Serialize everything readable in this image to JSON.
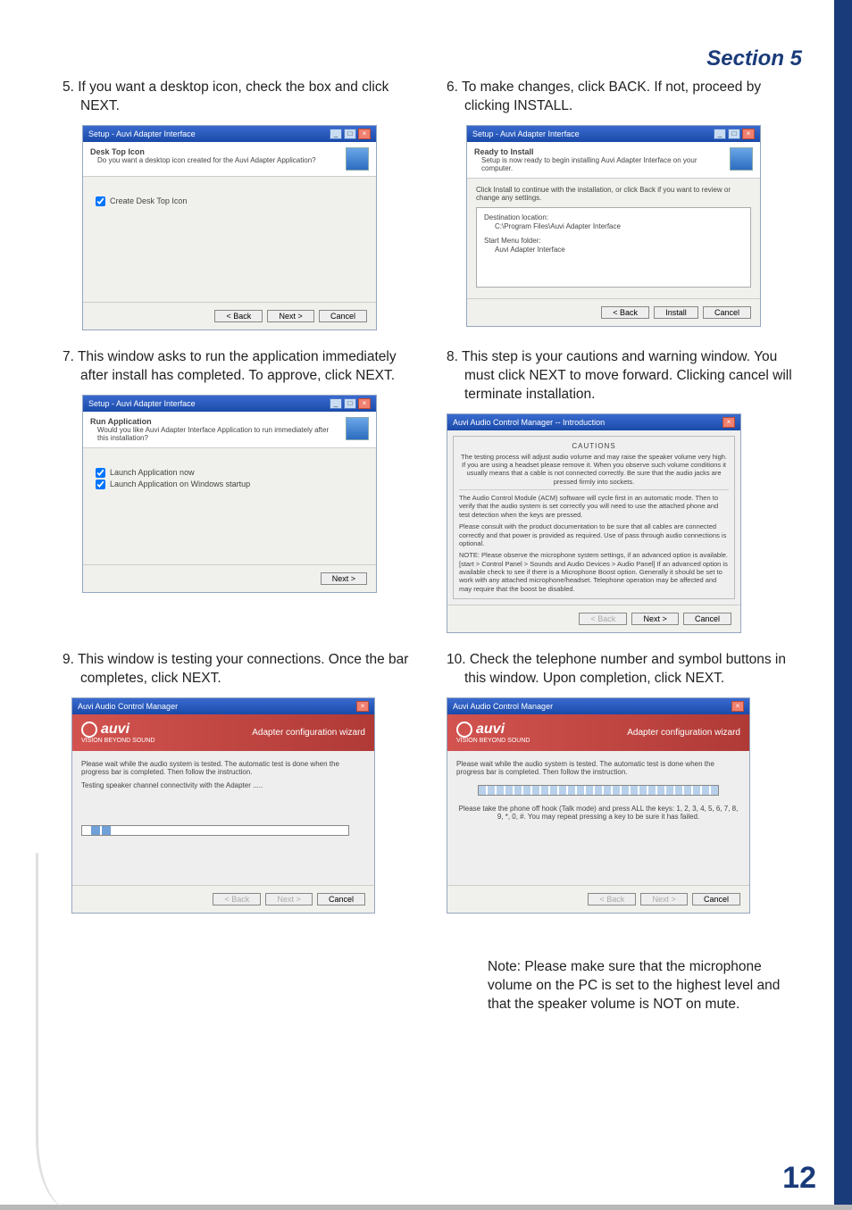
{
  "header": {
    "section_label": "Section 5"
  },
  "page_number": "12",
  "steps": {
    "s5": {
      "text": "5. If you want a desktop icon, check the box and click NEXT.",
      "win_title": "Setup - Auvi Adapter Interface",
      "sub_title": "Desk Top Icon",
      "sub_desc": "Do you want a desktop icon created for the Auvi Adapter Application?",
      "checkbox1": "Create Desk Top Icon",
      "btn_back": "< Back",
      "btn_next": "Next >",
      "btn_cancel": "Cancel"
    },
    "s6": {
      "text": "6. To make changes, click BACK. If not, proceed by clicking INSTALL.",
      "win_title": "Setup - Auvi Adapter Interface",
      "sub_title": "Ready to Install",
      "sub_desc": "Setup is now ready to begin installing Auvi Adapter Interface on your computer.",
      "body_intro": "Click Install to continue with the installation, or click Back if you want to review or change any settings.",
      "dest_label": "Destination location:",
      "dest_value": "C:\\Program Files\\Auvi Adapter Interface",
      "menu_label": "Start Menu folder:",
      "menu_value": "Auvi Adapter Interface",
      "btn_back": "< Back",
      "btn_install": "Install",
      "btn_cancel": "Cancel"
    },
    "s7": {
      "text": "7. This window asks to run the application immediately after install has completed. To approve, click NEXT.",
      "win_title": "Setup - Auvi Adapter Interface",
      "sub_title": "Run Application",
      "sub_desc": "Would you like Auvi Adapter Interface Application to run immediately after this installation?",
      "checkbox1": "Launch Application now",
      "checkbox2": "Launch Application on Windows startup",
      "btn_next": "Next >"
    },
    "s8": {
      "text": "8. This step is your cautions and warning window. You must click NEXT to move forward. Clicking cancel will terminate installation.",
      "win_title": "Auvi Audio Control Manager -- Introduction",
      "caution_head": "CAUTIONS",
      "caution_p1": "The testing process will adjust audio volume and may raise the speaker volume very high. If you are using a headset please remove it. When you observe such volume conditions it usually means that a cable is not connected correctly. Be sure that the audio jacks are pressed firmly into sockets.",
      "caution_p2": "The Audio Control Module (ACM) software will cycle first in an automatic mode. Then to verify that the audio system is set correctly you will need to use the attached phone and test detection when the keys are pressed.",
      "caution_p3": "Please consult with the product documentation to be sure that all cables are connected correctly and that power is provided as required. Use of pass through audio connections is optional.",
      "caution_p4": "NOTE: Please observe the microphone system settings, if an advanced option is available. [start > Control Panel > Sounds and Audio Devices > Audio Panel] If an advanced option is available check to see if there is a Microphone Boost option. Generally it should be set to work with any attached microphone/headset. Telephone operation may be affected and may require that the boost be disabled.",
      "btn_back": "< Back",
      "btn_next": "Next >",
      "btn_cancel": "Cancel"
    },
    "s9": {
      "text": "9. This window is testing your connections. Once the bar completes, click NEXT.",
      "win_title": "Auvi Audio Control Manager",
      "brand": "auvi",
      "brand_sub": "VISION BEYOND SOUND",
      "wiz_label": "Adapter configuration wizard",
      "body_p1": "Please wait while the audio system is tested. The automatic test is done when the progress bar is completed. Then follow the instruction.",
      "body_p2": "Testing speaker channel connectivity with the Adapter .....",
      "btn_back": "< Back",
      "btn_next": "Next >",
      "btn_cancel": "Cancel"
    },
    "s10": {
      "text": "10. Check the telephone number and symbol buttons in this window. Upon completion, click NEXT.",
      "win_title": "Auvi Audio Control Manager",
      "brand": "auvi",
      "brand_sub": "VISION BEYOND SOUND",
      "wiz_label": "Adapter configuration wizard",
      "body_p1": "Please wait while the audio system is tested. The automatic test is done when the progress bar is completed. Then follow the instruction.",
      "body_p2": "Please take the phone off hook (Talk mode) and press ALL the keys: 1, 2, 3, 4, 5, 6, 7, 8, 9, *, 0, #. You may repeat pressing a key to be sure it has failed.",
      "btn_back": "< Back",
      "btn_next": "Next >",
      "btn_cancel": "Cancel"
    }
  },
  "note": "Note: Please make sure that the microphone volume on the PC is set to the highest level and that the speaker volume is NOT on mute."
}
